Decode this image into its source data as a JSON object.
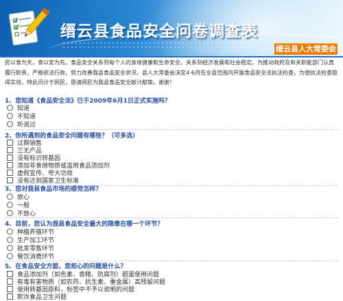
{
  "header": {
    "title": "缙云县食品安全问卷调查表",
    "org_badge": "缙云县人大常委会",
    "colors": {
      "banner": "#1a74c8",
      "badge": "#f07a00",
      "question": "#2b52a3"
    },
    "logo_icon": "survey-checklist-pencil-icon"
  },
  "intro": "民以食为天，食以安为先。食品安全关系到每个人的身体健康和生命安全，关系到经济发展和社会稳定。为推动政府及有关职能部门认真履行职责，严格依法行政，努力改善我县食品安全状况，县人大常委会决定4-6月在全县范围内开展食品安全法执法检查，为使执法检查取得实效，特此问计于网民，恳请网民为我县食品安全献计献策。谢谢！",
  "questions": [
    {
      "label": "1、您知道《食品安全法》已于2009年6月1日正式实施吗？",
      "type": "radio",
      "options": [
        "知道",
        "不知道",
        "听说过"
      ]
    },
    {
      "label": "2、你所遇到的食品安全问题有哪些？（可多选）",
      "type": "checkbox",
      "options": [
        "过期销售",
        "三无产品",
        "没有标识转基因",
        "添加非食用物质或滥用食品添加剂",
        "虚假宣传、夸大功效",
        "没有达到国家卫生标准"
      ]
    },
    {
      "label": "3、您对我县食品市场的感觉怎样？",
      "type": "radio",
      "options": [
        "放心",
        "一般",
        "不放心"
      ]
    },
    {
      "label": "4、目前，您认为我县食品安全最大的隐患在哪一个环节？",
      "type": "radio",
      "options": [
        "种植养殖环节",
        "生产加工环节",
        "批发零售环节",
        "餐饮消费环节"
      ]
    },
    {
      "label": "5、在食品安全方面，您担心的问题是什么？",
      "type": "checkbox",
      "options": [
        "食品添加剂（如色素、香精、防腐剂）超量使用问题",
        "有毒有害物质（如农药、抗生素、重金属）高残留问题",
        "使用转基因原料，标签中不予以说明的问题",
        "欺诈食品卫生问题"
      ]
    }
  ]
}
